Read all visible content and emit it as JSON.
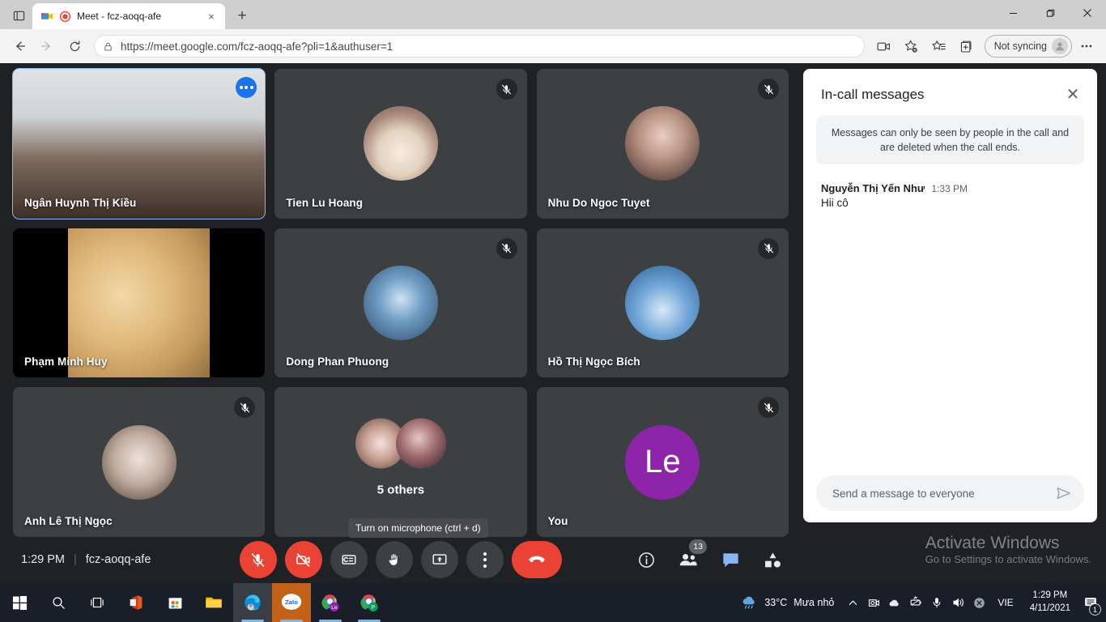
{
  "browser": {
    "tab": {
      "title": "Meet - fcz-aoqq-afe",
      "favicon": "google-meet-icon",
      "recording": "recording-indicator-icon",
      "close_label": "×"
    },
    "new_tab_label": "+",
    "window_controls": {
      "minimize": "minimize-icon",
      "maximize": "restore-icon",
      "close": "close-icon"
    },
    "nav": {
      "back": "back-arrow-icon",
      "forward": "forward-arrow-icon",
      "reload": "reload-icon"
    },
    "address": {
      "lock": "lock-icon",
      "url": "https://meet.google.com/fcz-aoqq-afe?pli=1&authuser=1"
    },
    "toolbar_right": {
      "cast": "screen-cast-icon",
      "favorite": "add-favorite-icon",
      "collections": "favorites-list-icon",
      "tab_actions": "add-collection-icon",
      "profile_label": "Not syncing",
      "settings": "more-options-icon"
    }
  },
  "meet": {
    "tiles": [
      {
        "name": "Ngân Huynh Thị Kiều",
        "type": "video",
        "active": true,
        "muted": false,
        "has_more": true,
        "photo": "ph-kieu",
        "letterbox": false
      },
      {
        "name": "Tien Lu Hoang",
        "type": "avatar",
        "active": false,
        "muted": true,
        "has_more": false,
        "photo": "ph-cat"
      },
      {
        "name": "Nhu Do Ngoc Tuyet",
        "type": "avatar",
        "active": false,
        "muted": true,
        "has_more": false,
        "photo": "ph-nhu"
      },
      {
        "name": "Phạm Minh Huy",
        "type": "video",
        "active": false,
        "muted": false,
        "has_more": false,
        "photo": "ph-doge",
        "letterbox": true
      },
      {
        "name": "Dong Phan Phuong",
        "type": "avatar",
        "active": false,
        "muted": true,
        "has_more": false,
        "photo": "ph-dong"
      },
      {
        "name": "Hồ Thị Ngọc Bích",
        "type": "avatar",
        "active": false,
        "muted": true,
        "has_more": false,
        "photo": "ph-bich"
      },
      {
        "name": "Anh Lê Thị Ngọc",
        "type": "avatar",
        "active": false,
        "muted": true,
        "has_more": false,
        "photo": "ph-anh"
      },
      {
        "name": "5 others",
        "type": "others",
        "active": false,
        "muted": false,
        "has_more": false
      },
      {
        "name": "You",
        "type": "initials",
        "active": false,
        "muted": true,
        "has_more": false,
        "initials": "Le",
        "avatar_color": "#8e24aa"
      }
    ],
    "tooltip": "Turn on microphone (ctrl + d)",
    "bottom_bar": {
      "time": "1:29 PM",
      "separator": "|",
      "meeting_code": "fcz-aoqq-afe",
      "controls": [
        {
          "name": "microphone-off-button",
          "icon": "mic-off-icon",
          "style": "danger"
        },
        {
          "name": "camera-off-button",
          "icon": "camera-off-icon",
          "style": "danger"
        },
        {
          "name": "captions-button",
          "icon": "closed-captions-icon",
          "style": "normal"
        },
        {
          "name": "raise-hand-button",
          "icon": "raised-hand-icon",
          "style": "normal"
        },
        {
          "name": "present-screen-button",
          "icon": "present-now-icon",
          "style": "normal"
        },
        {
          "name": "more-options-button",
          "icon": "more-vertical-icon",
          "style": "normal"
        },
        {
          "name": "leave-call-button",
          "icon": "end-call-icon",
          "style": "leave"
        }
      ],
      "right_controls": [
        {
          "name": "meeting-details-button",
          "icon": "info-icon",
          "badge": ""
        },
        {
          "name": "show-everyone-button",
          "icon": "people-icon",
          "badge": "13"
        },
        {
          "name": "chat-button",
          "icon": "chat-bubble-icon",
          "badge": ""
        },
        {
          "name": "activities-button",
          "icon": "activities-icon",
          "badge": ""
        }
      ]
    },
    "watermark": {
      "line1": "Activate Windows",
      "line2": "Go to Settings to activate Windows."
    }
  },
  "chat": {
    "title": "In-call messages",
    "close_label": "✕",
    "notice": "Messages can only be seen by people in the call and are deleted when the call ends.",
    "messages": [
      {
        "author": "Nguyễn Thị Yến Như",
        "time": "1:33 PM",
        "text": "Hii cô"
      }
    ],
    "input_placeholder": "Send a message to everyone",
    "send_icon": "send-icon"
  },
  "taskbar": {
    "items": [
      {
        "name": "start-button",
        "icon": "windows-logo-icon"
      },
      {
        "name": "search-button",
        "icon": "search-icon"
      },
      {
        "name": "task-view-button",
        "icon": "task-view-icon"
      },
      {
        "name": "office-app",
        "icon": "office-icon"
      },
      {
        "name": "microsoft-store-app",
        "icon": "store-icon"
      },
      {
        "name": "file-explorer-app",
        "icon": "folder-icon"
      },
      {
        "name": "microsoft-edge-app",
        "icon": "edge-icon"
      },
      {
        "name": "zalo-app",
        "icon": "zalo-icon",
        "label": "Zalo"
      },
      {
        "name": "chrome-profile-le-app",
        "icon": "chrome-icon",
        "label": "Le"
      },
      {
        "name": "chrome-profile-p-app",
        "icon": "chrome-icon",
        "label": "P"
      }
    ],
    "tray": {
      "weather_temp": "33°C",
      "weather_desc": "Mưa nhỏ",
      "chevron": "show-hidden-icons-icon",
      "icons": [
        "meet-tray-icon",
        "onedrive-icon",
        "battery-saver-icon",
        "microphone-icon",
        "volume-icon",
        "error-icon"
      ],
      "language": "VIE",
      "time": "1:29 PM",
      "date": "4/11/2021",
      "notification_count": "1"
    }
  }
}
